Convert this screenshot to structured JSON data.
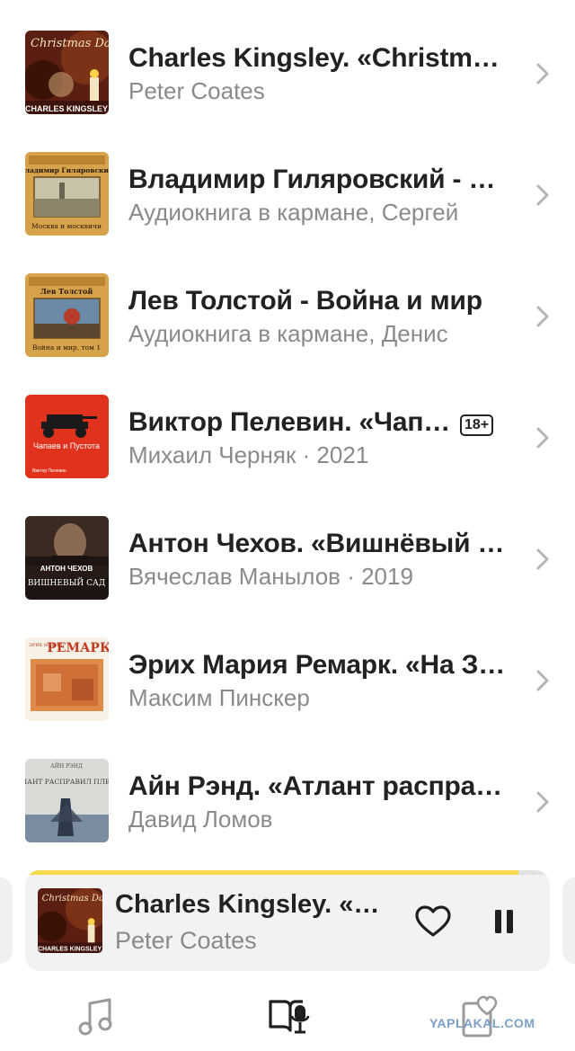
{
  "list": {
    "items": [
      {
        "title": "Charles Kingsley. «Christmas Day»",
        "subtitle": "Peter Coates",
        "cover_title": "Christmas Day",
        "cover_author": "CHARLES KINGSLEY",
        "badge": ""
      },
      {
        "title": "Владимир Гиляровский - Москва и москвичи",
        "subtitle": "Аудиокнига в кармане, Сергей",
        "cover_title": "Москва и москвичи",
        "cover_author": "Владимир Гиляровский",
        "badge": ""
      },
      {
        "title": "Лев Толстой - Война и мир",
        "subtitle": "Аудиокнига в кармане, Денис",
        "cover_title": "Война и мир, том 1",
        "cover_author": "Лев Толстой",
        "badge": ""
      },
      {
        "title": "Виктор Пелевин. «Чапаев и Пустота»",
        "subtitle": "Михаил Черняк · 2021",
        "cover_title": "Чапаев и Пустота",
        "cover_author": "Виктор Пелевин",
        "badge": "18+"
      },
      {
        "title": "Антон Чехов. «Вишнёвый сад»",
        "subtitle": "Вячеслав Манылов · 2019",
        "cover_title": "ВИШНЕВЫЙ САД",
        "cover_author": "АНТОН ЧЕХОВ",
        "badge": ""
      },
      {
        "title": "Эрих Мария Ремарк. «На Западном фронте без перемен»",
        "subtitle": "Максим Пинскер",
        "cover_title": "РЕМАРК",
        "cover_author": "ЭРИХ МАРИЯ",
        "badge": ""
      },
      {
        "title": "Айн Рэнд. «Атлант расправил плечи»",
        "subtitle": "Давид Ломов",
        "cover_title": "АТЛАНТ РАСПРАВИЛ ПЛЕЧИ",
        "cover_author": "АЙН РЭНД",
        "badge": ""
      }
    ]
  },
  "player": {
    "title": "Charles Kingsley. «Christmas Day»",
    "subtitle": "Peter Coates",
    "cover_title": "Christmas Day",
    "cover_author": "CHARLES KINGSLEY",
    "progress": 0.94,
    "progress_color": "#f5d94a"
  },
  "tabbar": {
    "tabs": [
      {
        "icon": "music-note-icon"
      },
      {
        "icon": "audiobook-icon",
        "active": true
      },
      {
        "icon": "favorites-icon"
      }
    ]
  },
  "watermark": "YAPLAKAL.COM"
}
